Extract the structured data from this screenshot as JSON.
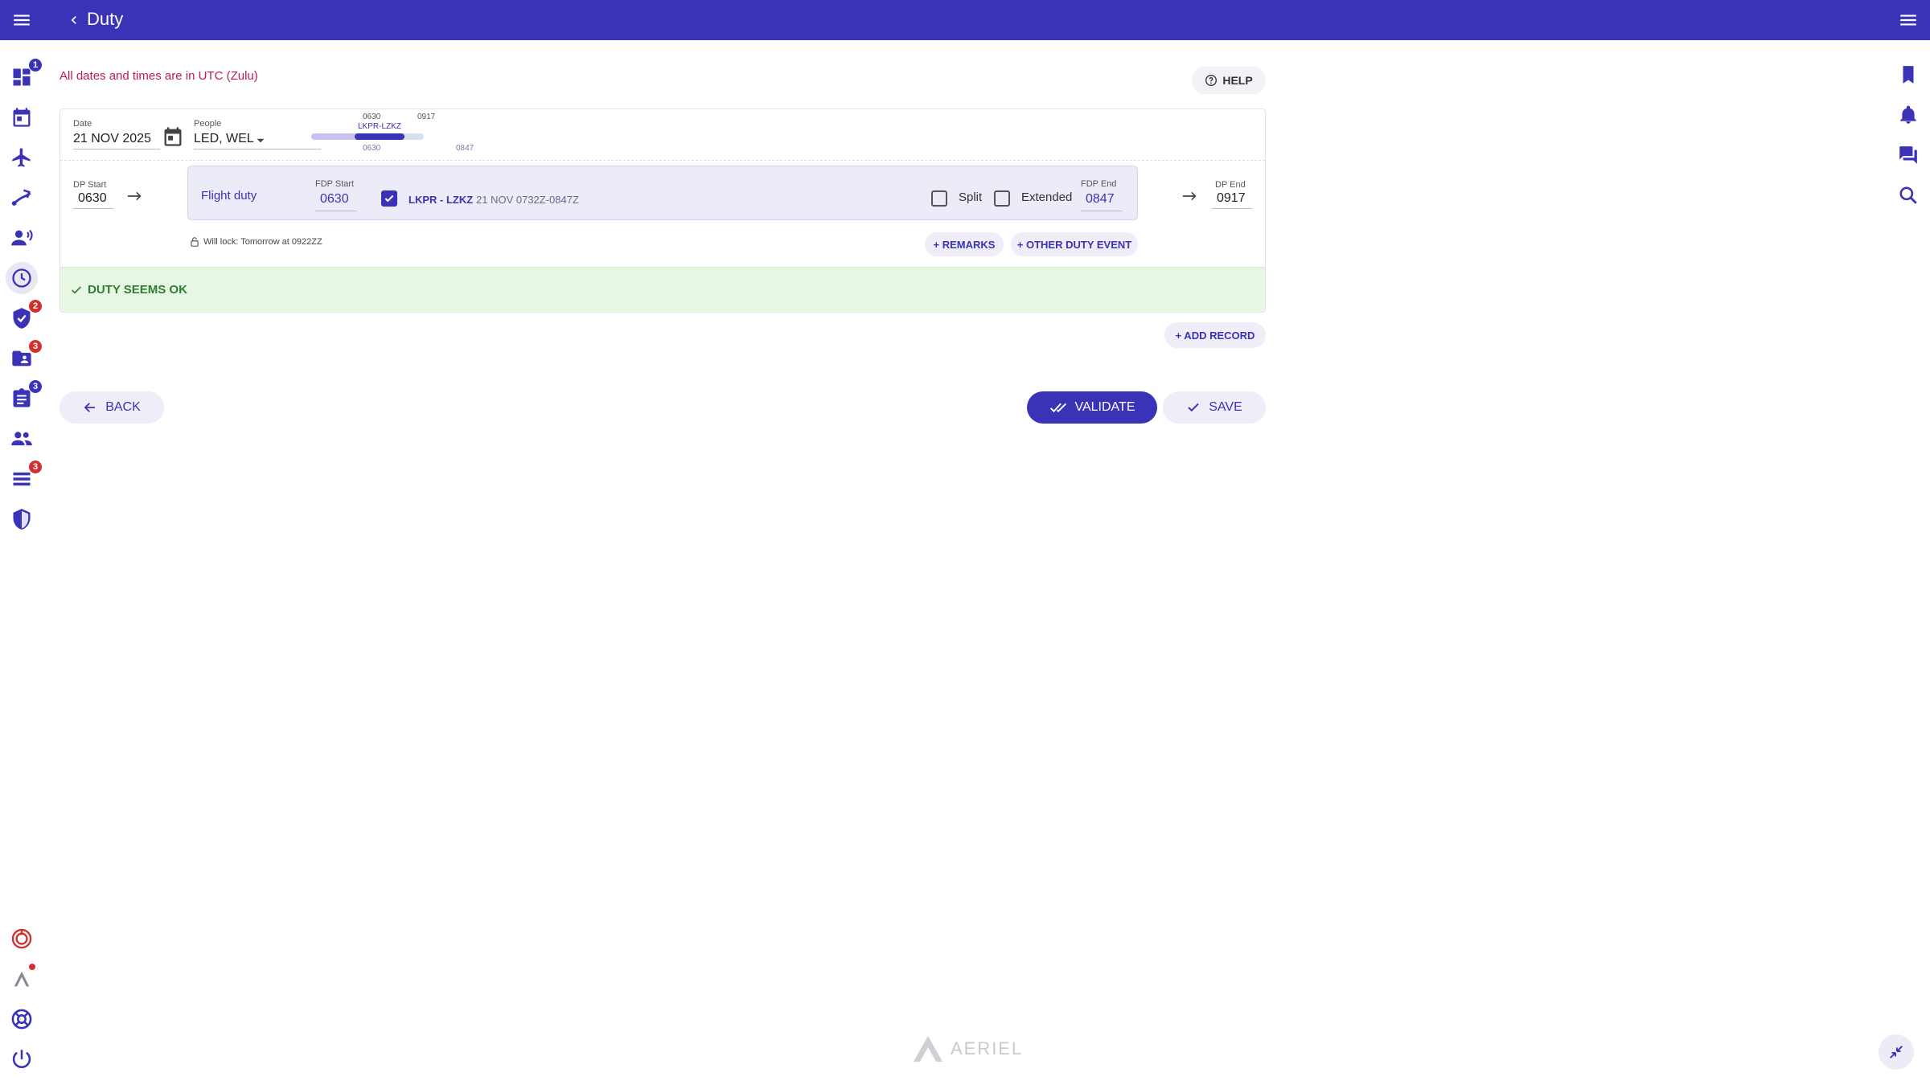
{
  "header": {
    "title": "Duty"
  },
  "sidebar": {
    "items": [
      {
        "icon": "dashboard-icon",
        "badge": "1",
        "badge_color": "#3a33b8"
      },
      {
        "icon": "calendar-icon"
      },
      {
        "icon": "airplane-icon"
      },
      {
        "icon": "flight-route-icon"
      },
      {
        "icon": "crew-briefing-icon"
      },
      {
        "icon": "clock-icon",
        "active": true
      },
      {
        "icon": "verified-shield-icon",
        "badge": "2",
        "badge_color": "#d32f2f"
      },
      {
        "icon": "contact-folder-icon",
        "badge": "3",
        "badge_color": "#d32f2f"
      },
      {
        "icon": "clipboard-icon",
        "badge": "3",
        "badge_color": "#3a33b8"
      },
      {
        "icon": "people-icon"
      },
      {
        "icon": "list-icon",
        "badge": "3",
        "badge_color": "#d32f2f"
      },
      {
        "icon": "security-shield-icon"
      }
    ],
    "bottom": [
      {
        "icon": "target-icon"
      },
      {
        "icon": "aeriel-logo-icon",
        "dot": true
      },
      {
        "icon": "lifebuoy-icon"
      },
      {
        "icon": "power-icon"
      }
    ]
  },
  "right_rail": [
    "bookmark-icon",
    "bell-icon",
    "chat-icon",
    "search-icon"
  ],
  "notice": "All dates and times are in UTC (Zulu)",
  "help_label": "HELP",
  "record": {
    "date_label": "Date",
    "date_value": "21 NOV 2025",
    "people_label": "People",
    "people_value": "LED, WEL",
    "timeline": {
      "top_start": "0630",
      "top_end": "0917",
      "route": "LKPR-LZKZ",
      "bottom_start": "0630",
      "bottom_end": "0847"
    },
    "dp_start_label": "DP Start",
    "dp_start_value": "0630",
    "duty_type": "Flight duty",
    "fdp_start_label": "FDP Start",
    "fdp_start_value": "0630",
    "leg_checked": true,
    "leg_route": "LKPR - LZKZ",
    "leg_time": "21 NOV 0732Z-0847Z",
    "split_label": "Split",
    "split_checked": false,
    "extended_label": "Extended",
    "extended_checked": false,
    "fdp_end_label": "FDP End",
    "fdp_end_value": "0847",
    "dp_end_label": "DP End",
    "dp_end_value": "0917",
    "lock_text": "Will lock: Tomorrow at 0922ZZ",
    "remarks_label": "+ REMARKS",
    "other_event_label": "+ OTHER DUTY EVENT",
    "status_text": "DUTY SEEMS OK",
    "status_color": "#2e7d32"
  },
  "add_record_label": "+ ADD RECORD",
  "actions": {
    "back_label": "BACK",
    "validate_label": "VALIDATE",
    "save_label": "SAVE"
  },
  "brand": "AERIEL",
  "colors": {
    "primary": "#3a33b8",
    "alert": "#c2185b",
    "success": "#2e7d32",
    "badge_red": "#d32f2f"
  }
}
